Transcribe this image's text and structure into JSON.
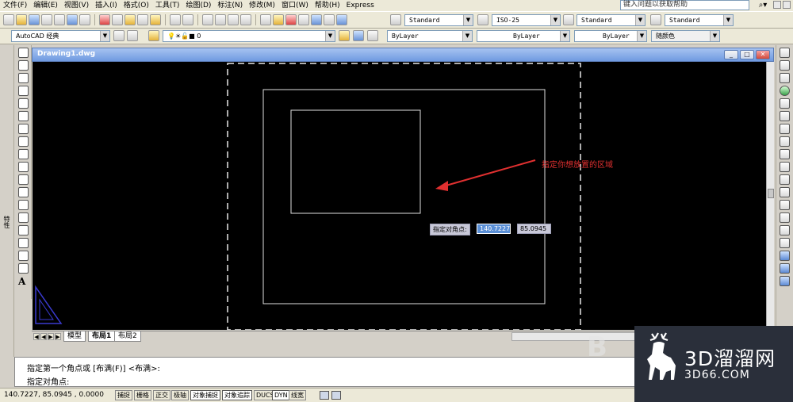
{
  "menu": [
    "文件(F)",
    "编辑(E)",
    "视图(V)",
    "插入(I)",
    "格式(O)",
    "工具(T)",
    "绘图(D)",
    "标注(N)",
    "修改(M)",
    "窗口(W)",
    "帮助(H)",
    "Express"
  ],
  "help_search": {
    "placeholder": "键入问题以获取帮助"
  },
  "styles": {
    "text_style": "Standard",
    "dim_style": "ISO-25",
    "table_style": "Standard",
    "multileader_style": "Standard"
  },
  "workspace": "AutoCAD 经典",
  "layer": "0",
  "properties": {
    "color": "ByLayer",
    "linetype": "ByLayer",
    "lineweight": "ByLayer",
    "plotstyle": "随颜色"
  },
  "drawing": {
    "title": "Drawing1.dwg",
    "window_buttons": [
      "_",
      "□",
      "✕"
    ]
  },
  "layout_tabs": [
    "模型",
    "布局1",
    "布局2"
  ],
  "active_tab": "布局1",
  "dynamic_input": {
    "prompt": "指定对角点:",
    "x": "140.7227",
    "y": "85.0945"
  },
  "annotation": "指定你想放置的区域",
  "left_palette_label": "特性",
  "command": {
    "line1": "指定第一个角点或 [布满(F)] <布满>:",
    "line2": "指定对角点:"
  },
  "status": {
    "coords": "140.7227, 85.0945 , 0.0000",
    "toggles": [
      "捕捉",
      "栅格",
      "正交",
      "极轴",
      "对象捕捉",
      "对象追踪",
      "DUCS",
      "DYN",
      "线宽"
    ]
  },
  "watermark": {
    "text": "3D溜溜网",
    "url": "3D66.COM"
  },
  "colors": {
    "canvas": "#000000",
    "annotation": "#e03030",
    "titlebar": "#6f9ae1"
  }
}
